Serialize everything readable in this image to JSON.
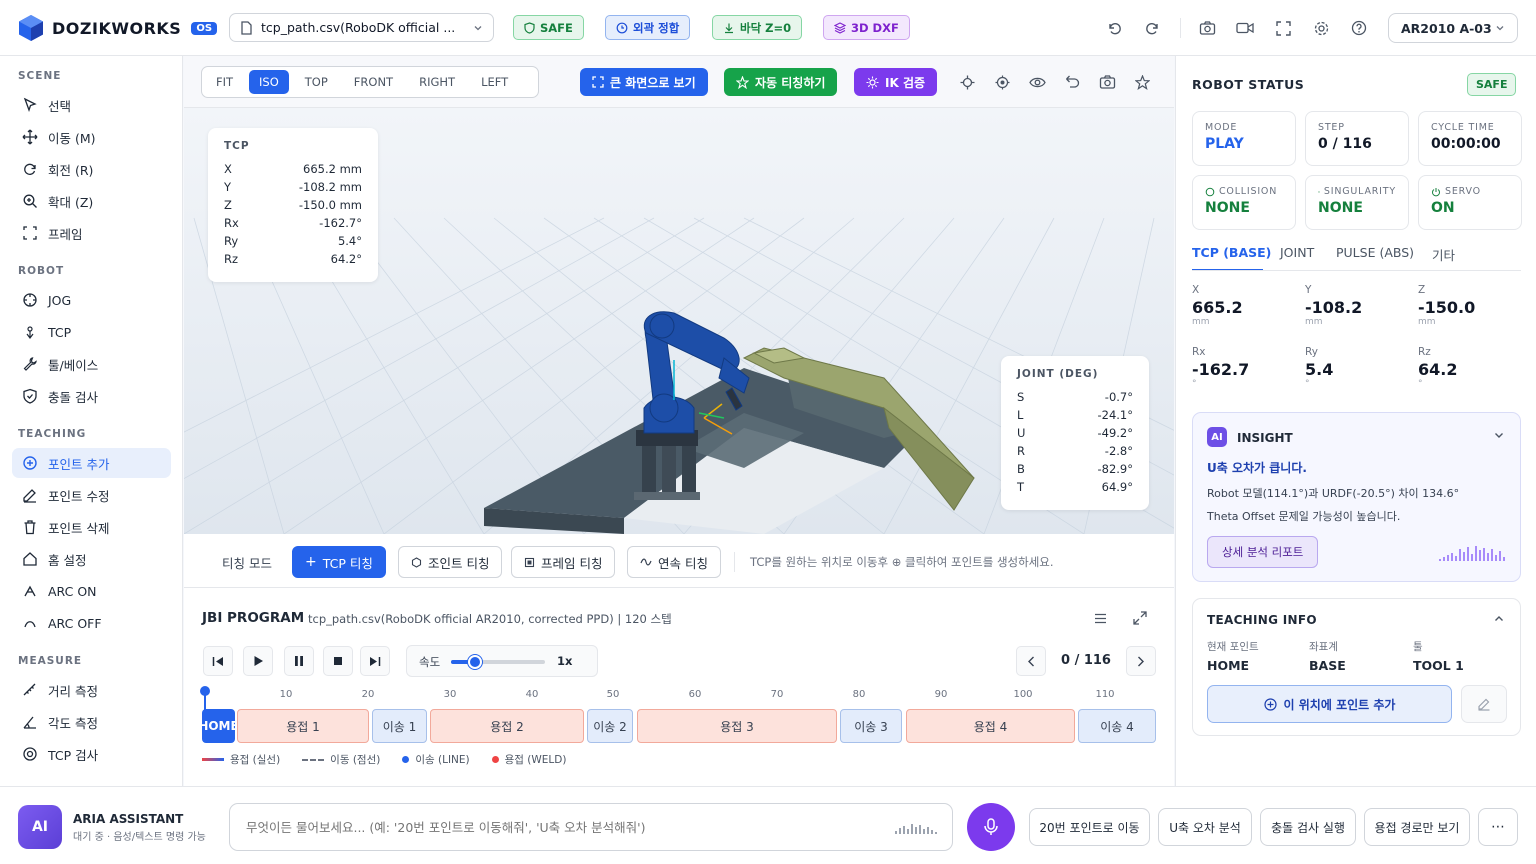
{
  "header": {
    "brand": "DOZIKWORKS",
    "brand_badge": "OS",
    "file": "tcp_path.csv(RoboDK official ...",
    "badges": [
      {
        "label": "SAFE",
        "color": "#15803d",
        "bg": "#e7f6ec",
        "border": "#86d6a4"
      },
      {
        "label": "외곽 정합",
        "color": "#1d4ed8",
        "bg": "#e6eefc",
        "border": "#93b4ef"
      },
      {
        "label": "바닥 Z=0",
        "color": "#15803d",
        "bg": "#e7f6ec",
        "border": "#86d6a4"
      },
      {
        "label": "3D DXF",
        "color": "#7e22ce",
        "bg": "#f3e8fd",
        "border": "#cfa6f0"
      }
    ],
    "robot": "AR2010 A-03"
  },
  "sidebar": {
    "sections": [
      {
        "title": "SCENE",
        "items": [
          {
            "label": "선택",
            "icon": "cursor-icon"
          },
          {
            "label": "이동 (M)",
            "icon": "move-icon"
          },
          {
            "label": "회전 (R)",
            "icon": "rotate-icon"
          },
          {
            "label": "확대 (Z)",
            "icon": "zoom-icon"
          },
          {
            "label": "프레임",
            "icon": "frame-icon"
          }
        ]
      },
      {
        "title": "ROBOT",
        "items": [
          {
            "label": "JOG",
            "icon": "jog-icon"
          },
          {
            "label": "TCP",
            "icon": "tcp-icon"
          },
          {
            "label": "툴/베이스",
            "icon": "wrench-icon"
          },
          {
            "label": "충돌 검사",
            "icon": "shield-icon"
          }
        ]
      },
      {
        "title": "TEACHING",
        "items": [
          {
            "label": "포인트 추가",
            "icon": "plus-circle-icon"
          },
          {
            "label": "포인트 수정",
            "icon": "edit-icon"
          },
          {
            "label": "포인트 삭제",
            "icon": "trash-icon"
          },
          {
            "label": "홈 설정",
            "icon": "home-icon"
          },
          {
            "label": "ARC ON",
            "icon": "arc-on-icon"
          },
          {
            "label": "ARC OFF",
            "icon": "arc-off-icon"
          }
        ]
      },
      {
        "title": "MEASURE",
        "items": [
          {
            "label": "거리 측정",
            "icon": "ruler-icon"
          },
          {
            "label": "각도 측정",
            "icon": "angle-icon"
          },
          {
            "label": "TCP 검사",
            "icon": "target-icon"
          }
        ]
      }
    ]
  },
  "view": {
    "buttons": [
      "FIT",
      "ISO",
      "TOP",
      "FRONT",
      "RIGHT",
      "LEFT"
    ],
    "actions": [
      {
        "label": "큰 화면으로 보기",
        "bg": "#2563eb"
      },
      {
        "label": "자동 티칭하기",
        "bg": "#16a34a"
      },
      {
        "label": "IK 검증",
        "bg": "#7c3aed"
      }
    ]
  },
  "tcp_overlay": {
    "title": "TCP",
    "rows": [
      {
        "k": "X",
        "v": "665.2 mm"
      },
      {
        "k": "Y",
        "v": "-108.2 mm"
      },
      {
        "k": "Z",
        "v": "-150.0 mm"
      },
      {
        "k": "Rx",
        "v": "-162.7°"
      },
      {
        "k": "Ry",
        "v": "5.4°"
      },
      {
        "k": "Rz",
        "v": "64.2°"
      }
    ]
  },
  "joint_overlay": {
    "title": "JOINT (DEG)",
    "rows": [
      {
        "k": "S",
        "v": "-0.7°"
      },
      {
        "k": "L",
        "v": "-24.1°"
      },
      {
        "k": "U",
        "v": "-49.2°"
      },
      {
        "k": "R",
        "v": "-2.8°"
      },
      {
        "k": "B",
        "v": "-82.9°"
      },
      {
        "k": "T",
        "v": "64.9°"
      }
    ]
  },
  "teaching": {
    "mode_label": "티칭 모드",
    "buttons": [
      "TCP 티칭",
      "조인트 티칭",
      "프레임 티칭",
      "연속 티칭"
    ],
    "hint": "TCP를 원하는 위치로 이동후 ⊕ 클릭하여 포인트를 생성하세요."
  },
  "program": {
    "title": "JBI PROGRAM",
    "subtitle": "tcp_path.csv(RoboDK official AR2010, corrected PPD)  |  120 스텝",
    "speed_label": "속도",
    "speed_value": "1x",
    "speed_fraction": 0.25,
    "step": "0 / 116",
    "ticks": [
      "10",
      "20",
      "30",
      "40",
      "50",
      "60",
      "70",
      "80",
      "90",
      "100",
      "110"
    ],
    "segments": [
      {
        "label": "HOME",
        "kind": "h"
      },
      {
        "label": "용접 1",
        "kind": "w"
      },
      {
        "label": "이송 1",
        "kind": "m"
      },
      {
        "label": "용접 2",
        "kind": "w"
      },
      {
        "label": "이송 2",
        "kind": "m"
      },
      {
        "label": "용접 3",
        "kind": "w"
      },
      {
        "label": "이송 3",
        "kind": "m"
      },
      {
        "label": "용접 4",
        "kind": "w"
      },
      {
        "label": "이송 4",
        "kind": "m"
      }
    ],
    "legend": [
      "용접 (실선)",
      "이동 (점선)",
      "이송 (LINE)",
      "용접 (WELD)"
    ]
  },
  "status": {
    "title": "ROBOT STATUS",
    "badge": "SAFE",
    "cards": [
      {
        "label": "MODE",
        "value": "PLAY",
        "color": "#2563eb"
      },
      {
        "label": "STEP",
        "value": "0 / 116",
        "color": "#111827"
      },
      {
        "label": "CYCLE TIME",
        "value": "00:00:00",
        "color": "#111827"
      },
      {
        "label": "COLLISION",
        "value": "NONE",
        "color": "#15803d"
      },
      {
        "label": "SINGULARITY",
        "value": "NONE",
        "color": "#15803d"
      },
      {
        "label": "SERVO",
        "value": "ON",
        "color": "#15803d"
      }
    ],
    "tabs": [
      "TCP (BASE)",
      "JOINT",
      "PULSE (ABS)",
      "기타"
    ],
    "coords": [
      {
        "k": "X",
        "v": "665.2",
        "u": "mm"
      },
      {
        "k": "Y",
        "v": "-108.2",
        "u": "mm"
      },
      {
        "k": "Z",
        "v": "-150.0",
        "u": "mm"
      },
      {
        "k": "Rx",
        "v": "-162.7",
        "u": "°"
      },
      {
        "k": "Ry",
        "v": "5.4",
        "u": "°"
      },
      {
        "k": "Rz",
        "v": "64.2",
        "u": "°"
      }
    ]
  },
  "insight": {
    "badge": "AI",
    "title": "INSIGHT",
    "headline": "U축 오차가 큽니다.",
    "line1": "Robot 모델(114.1°)과 URDF(-20.5°) 차이 134.6°",
    "line2": "Theta Offset 문제일 가능성이 높습니다.",
    "button": "상세 분석 리포트"
  },
  "teaching_info": {
    "title": "TEACHING INFO",
    "fields": [
      {
        "k": "현재 포인트",
        "v": "HOME"
      },
      {
        "k": "좌표계",
        "v": "BASE"
      },
      {
        "k": "툴",
        "v": "TOOL 1"
      }
    ],
    "add_button": "이 위치에 포인트 추가"
  },
  "assistant": {
    "avatar": "AI",
    "name": "ARIA ASSISTANT",
    "status": "대기 중 · 음성/텍스트 명령 가능",
    "placeholder": "무엇이든 물어보세요... (예: '20번 포인트로 이동해줘', 'U축 오차 분석해줘')",
    "quick": [
      "20번 포인트로 이동",
      "U축 오차 분석",
      "충돌 검사 실행",
      "용접 경로만 보기"
    ],
    "more": "⋯"
  }
}
